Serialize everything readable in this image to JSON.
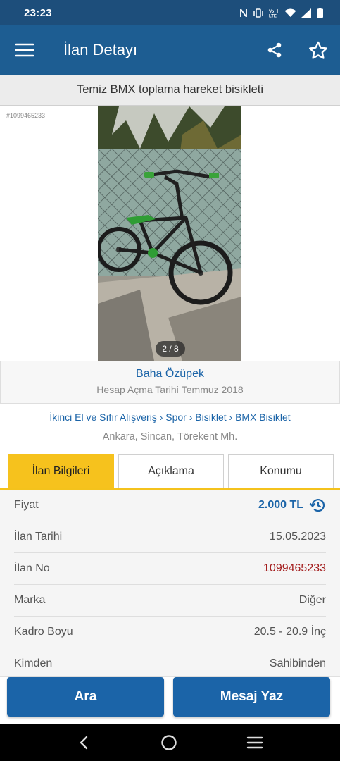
{
  "status_bar": {
    "time": "23:23"
  },
  "app_bar": {
    "title": "İlan Detayı"
  },
  "listing": {
    "title": "Temiz BMX toplama hareket bisikleti",
    "id_tag": "#1099465233",
    "photo_counter": "2 / 8"
  },
  "seller": {
    "name": "Baha Özüpek",
    "since_label": "Hesap Açma Tarihi",
    "since_value": "Temmuz 2018"
  },
  "breadcrumb": "İkinci El ve Sıfır Alışveriş › Spor › Bisiklet › BMX Bisiklet",
  "location": "Ankara, Sincan, Törekent Mh.",
  "tabs": [
    {
      "label": "İlan Bilgileri",
      "active": true
    },
    {
      "label": "Açıklama",
      "active": false
    },
    {
      "label": "Konumu",
      "active": false
    }
  ],
  "info": [
    {
      "label": "Fiyat",
      "value": "2.000 TL"
    },
    {
      "label": "İlan Tarihi",
      "value": "15.05.2023"
    },
    {
      "label": "İlan No",
      "value": "1099465233"
    },
    {
      "label": "Marka",
      "value": "Diğer"
    },
    {
      "label": "Kadro Boyu",
      "value": "20.5 - 20.9 İnç"
    },
    {
      "label": "Kimden",
      "value": "Sahibinden"
    }
  ],
  "actions": {
    "call": "Ara",
    "message": "Mesaj Yaz"
  },
  "colors": {
    "app_bar": "#1d5d92",
    "status_bar": "#1d4e7b",
    "accent_blue": "#1b64a8",
    "tab_active": "#f6c21d",
    "listing_id": "#a31c1c"
  }
}
